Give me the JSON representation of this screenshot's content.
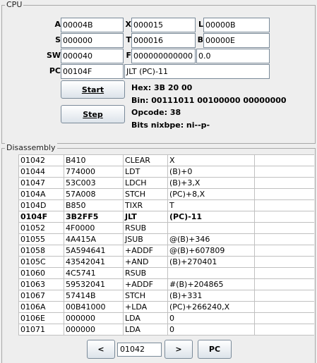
{
  "cpu": {
    "title": "CPU",
    "registers": {
      "A": {
        "label": "A",
        "value": "00004B"
      },
      "X": {
        "label": "X",
        "value": "000015"
      },
      "L": {
        "label": "L",
        "value": "00000B"
      },
      "S": {
        "label": "S",
        "value": "000000"
      },
      "T": {
        "label": "T",
        "value": "000016"
      },
      "B": {
        "label": "B",
        "value": "00000E"
      },
      "SW": {
        "label": "SW",
        "value": "000040"
      },
      "F": {
        "label": "F",
        "value": "000000000000"
      },
      "F_dec": {
        "value": "0.0"
      },
      "PC": {
        "label": "PC",
        "value": "00104F"
      }
    },
    "current_instruction": "JLT (PC)-11",
    "buttons": {
      "start": "Start",
      "step": "Step"
    },
    "info": {
      "hex": "Hex: 3B 20 00",
      "bin": "Bin: 00111011 00100000 00000000",
      "opcode": "Opcode: 38",
      "bits": "Bits nixbpe: ni--p-"
    }
  },
  "disassembly": {
    "title": "Disassembly",
    "selected_index": 5,
    "rows": [
      [
        "01042",
        "B410",
        "CLEAR",
        "X"
      ],
      [
        "01044",
        "774000",
        "LDT",
        "(B)+0"
      ],
      [
        "01047",
        "53C003",
        "LDCH",
        "(B)+3,X"
      ],
      [
        "0104A",
        "57A008",
        "STCH",
        "(PC)+8,X"
      ],
      [
        "0104D",
        "B850",
        "TIXR",
        "T"
      ],
      [
        "0104F",
        "3B2FF5",
        "JLT",
        "(PC)-11"
      ],
      [
        "01052",
        "4F0000",
        "RSUB",
        ""
      ],
      [
        "01055",
        "4A415A",
        "JSUB",
        "@(B)+346"
      ],
      [
        "01058",
        "5A594641",
        "+ADDF",
        "@(B)+607809"
      ],
      [
        "0105C",
        "43542041",
        "+AND",
        "(B)+270401"
      ],
      [
        "01060",
        "4C5741",
        "RSUB",
        ""
      ],
      [
        "01063",
        "59532041",
        "+ADDF",
        "#(B)+204865"
      ],
      [
        "01067",
        "57414B",
        "STCH",
        "(B)+331"
      ],
      [
        "0106A",
        "00B41000",
        "+LDA",
        "(PC)+266240,X"
      ],
      [
        "0106E",
        "000000",
        "LDA",
        "0"
      ],
      [
        "01071",
        "000000",
        "LDA",
        "0"
      ]
    ],
    "nav": {
      "prev": "<",
      "address": "01042",
      "next": ">",
      "pc": "PC"
    }
  }
}
